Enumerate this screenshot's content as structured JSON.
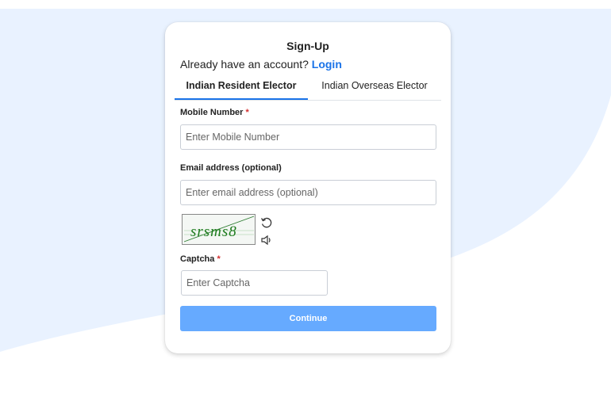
{
  "signup": {
    "title": "Sign-Up",
    "account_prompt": "Already have an account?",
    "login_link": "Login"
  },
  "tabs": [
    {
      "label": "Indian Resident Elector",
      "active": true
    },
    {
      "label": "Indian Overseas Elector",
      "active": false
    }
  ],
  "form": {
    "mobile_label": "Mobile Number",
    "mobile_placeholder": "Enter Mobile Number",
    "email_label": "Email address (optional)",
    "email_placeholder": "Enter email address (optional)",
    "captcha_text": "srsms8",
    "captcha_label": "Captcha",
    "captcha_placeholder": "Enter Captcha",
    "required_marker": "*",
    "continue_label": "Continue"
  },
  "icons": {
    "refresh": "refresh-icon",
    "audio": "speaker-icon"
  },
  "colors": {
    "accent": "#1a73e8",
    "button": "#66aaff",
    "background_shape": "#e9f2ff",
    "captcha_text": "#1b7a1b",
    "required": "#d32f2f"
  }
}
